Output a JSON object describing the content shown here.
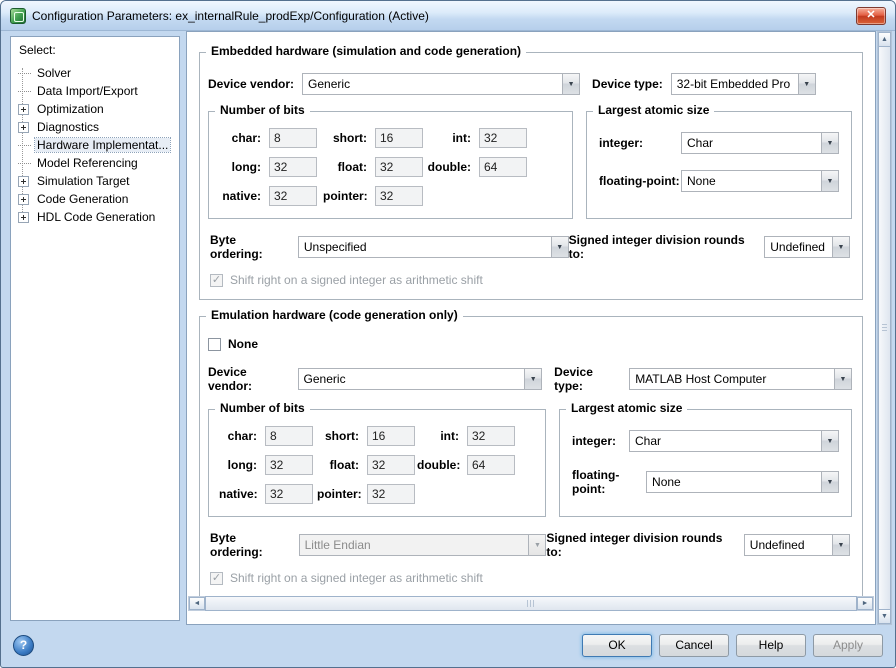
{
  "window": {
    "title": "Configuration Parameters: ex_internalRule_prodExp/Configuration (Active)"
  },
  "icons": {
    "close": "✕",
    "dropdown": "▼",
    "check": "✓",
    "help": "?",
    "up": "▲",
    "down": "▼",
    "left": "◄",
    "right": "►"
  },
  "sidebar": {
    "label": "Select:",
    "items": [
      {
        "label": "Solver"
      },
      {
        "label": "Data Import/Export"
      },
      {
        "label": "Optimization"
      },
      {
        "label": "Diagnostics"
      },
      {
        "label": "Hardware Implementat..."
      },
      {
        "label": "Model Referencing"
      },
      {
        "label": "Simulation Target"
      },
      {
        "label": "Code Generation"
      },
      {
        "label": "HDL Code Generation"
      }
    ]
  },
  "embedded": {
    "title": "Embedded hardware (simulation and code generation)",
    "device_vendor": {
      "label": "Device vendor:",
      "value": "Generic"
    },
    "device_type": {
      "label": "Device type:",
      "value": "32-bit Embedded Pro"
    },
    "bits": {
      "title": "Number of bits",
      "fields": [
        {
          "label": "char:",
          "value": "8"
        },
        {
          "label": "short:",
          "value": "16"
        },
        {
          "label": "int:",
          "value": "32"
        },
        {
          "label": "long:",
          "value": "32"
        },
        {
          "label": "float:",
          "value": "32"
        },
        {
          "label": "double:",
          "value": "64"
        },
        {
          "label": "native:",
          "value": "32"
        },
        {
          "label": "pointer:",
          "value": "32"
        }
      ]
    },
    "atomic": {
      "title": "Largest atomic size",
      "integer": {
        "label": "integer:",
        "value": "Char"
      },
      "floating": {
        "label": "floating-point:",
        "value": "None"
      }
    },
    "byte_ordering": {
      "label": "Byte ordering:",
      "value": "Unspecified"
    },
    "signed_div": {
      "label": "Signed integer division rounds to:",
      "value": "Undefined"
    },
    "shift_right": {
      "label": "Shift right on a signed integer as arithmetic shift",
      "checked": true
    }
  },
  "emulation": {
    "title": "Emulation hardware (code generation only)",
    "none_checkbox": {
      "label": "None",
      "checked": false
    },
    "device_vendor": {
      "label": "Device vendor:",
      "value": "Generic"
    },
    "device_type": {
      "label": "Device type:",
      "value": "MATLAB Host Computer"
    },
    "bits": {
      "title": "Number of bits",
      "fields": [
        {
          "label": "char:",
          "value": "8"
        },
        {
          "label": "short:",
          "value": "16"
        },
        {
          "label": "int:",
          "value": "32"
        },
        {
          "label": "long:",
          "value": "32"
        },
        {
          "label": "float:",
          "value": "32"
        },
        {
          "label": "double:",
          "value": "64"
        },
        {
          "label": "native:",
          "value": "32"
        },
        {
          "label": "pointer:",
          "value": "32"
        }
      ]
    },
    "atomic": {
      "title": "Largest atomic size",
      "integer": {
        "label": "integer:",
        "value": "Char"
      },
      "floating": {
        "label": "floating-point:",
        "value": "None"
      }
    },
    "byte_ordering": {
      "label": "Byte ordering:",
      "value": "Little Endian",
      "disabled": true
    },
    "signed_div": {
      "label": "Signed integer division rounds to:",
      "value": "Undefined"
    },
    "shift_right": {
      "label": "Shift right on a signed integer as arithmetic shift",
      "checked": true
    }
  },
  "footer": {
    "ok": "OK",
    "cancel": "Cancel",
    "help": "Help",
    "apply": "Apply"
  }
}
